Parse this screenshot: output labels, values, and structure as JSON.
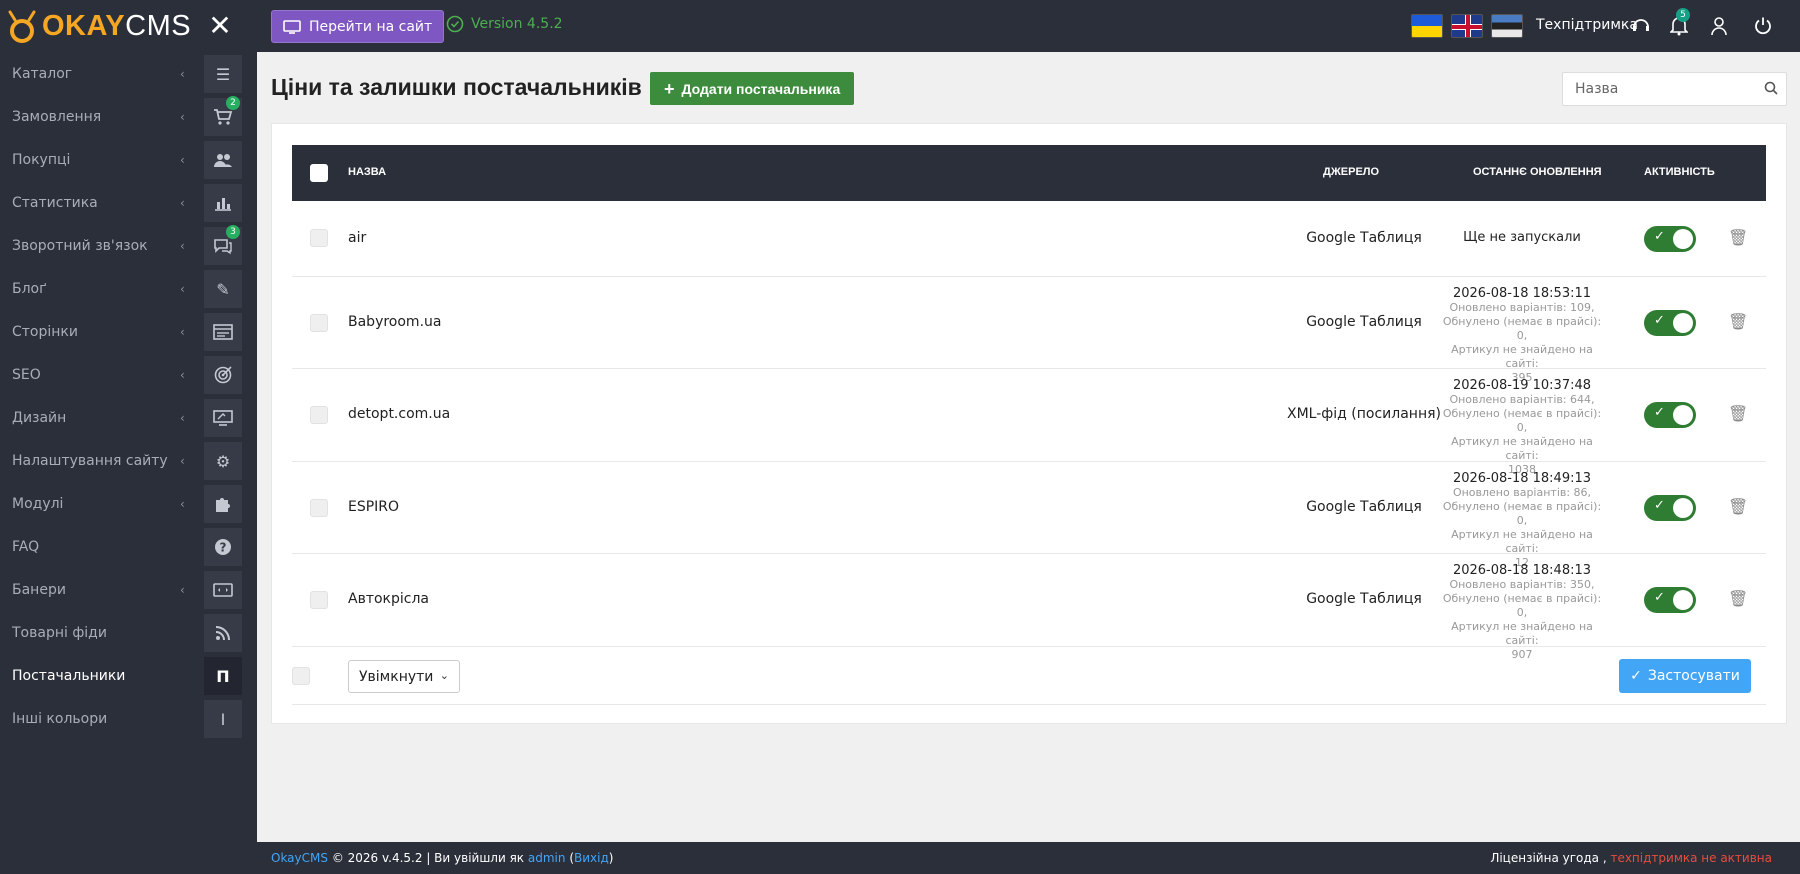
{
  "topbar": {
    "logo_okay": "OKAY",
    "logo_cms": "CMS",
    "goto_site": "Перейти на сайт",
    "version": "Version 4.5.2",
    "support": "Техпідтримка",
    "notifications_count": "5"
  },
  "sidebar": {
    "items": [
      {
        "label": "Каталог",
        "icon": "list-icon",
        "badge": ""
      },
      {
        "label": "Замовлення",
        "icon": "cart-icon",
        "badge": "2"
      },
      {
        "label": "Покупці",
        "icon": "users-icon",
        "badge": ""
      },
      {
        "label": "Статистика",
        "icon": "chart-icon",
        "badge": ""
      },
      {
        "label": "Зворотний зв'язок",
        "icon": "comments-icon",
        "badge": "3"
      },
      {
        "label": "Блоґ",
        "icon": "pencil-icon",
        "badge": ""
      },
      {
        "label": "Сторінки",
        "icon": "pages-icon",
        "badge": ""
      },
      {
        "label": "SEO",
        "icon": "target-icon",
        "badge": ""
      },
      {
        "label": "Дизайн",
        "icon": "monitor-icon",
        "badge": ""
      },
      {
        "label": "Налаштування сайту",
        "icon": "gear-icon",
        "badge": ""
      },
      {
        "label": "Модулі",
        "icon": "puzzle-icon",
        "badge": ""
      },
      {
        "label": "FAQ",
        "icon": "question-icon",
        "badge": ""
      },
      {
        "label": "Банери",
        "icon": "banner-icon",
        "badge": ""
      },
      {
        "label": "Товарні фіди",
        "icon": "rss-icon",
        "badge": ""
      },
      {
        "label": "Постачальники",
        "icon": "letter-p-icon",
        "badge": "",
        "letter": "П"
      },
      {
        "label": "Інші кольори",
        "icon": "letter-i-icon",
        "badge": "",
        "letter": "І"
      }
    ]
  },
  "main": {
    "title": "Ціни та залишки постачальників",
    "add_button": "Додати постачальника",
    "search_placeholder": "Назва",
    "table": {
      "headers": {
        "name": "Назва",
        "source": "Джерело",
        "last_update": "Останнє оновлення",
        "activity": "Активність"
      },
      "rows": [
        {
          "name": "air",
          "source": "Google Таблиця",
          "date": "Ще не запускали",
          "info": []
        },
        {
          "name": "Babyroom.ua",
          "source": "Google Таблиця",
          "date": "2026-08-18 18:53:11",
          "info": [
            "Оновлено варіантів: 109,",
            "Обнулено (немає в прайсі): 0,",
            "Артикул не знайдено на сайті:",
            "395"
          ]
        },
        {
          "name": "detopt.com.ua",
          "source": "XML-фід (посилання)",
          "date": "2026-08-19 10:37:48",
          "info": [
            "Оновлено варіантів: 644,",
            "Обнулено (немає в прайсі): 0,",
            "Артикул не знайдено на сайті:",
            "1038"
          ]
        },
        {
          "name": "ESPIRO",
          "source": "Google Таблиця",
          "date": "2026-08-18 18:49:13",
          "info": [
            "Оновлено варіантів: 86,",
            "Обнулено (немає в прайсі): 0,",
            "Артикул не знайдено на сайті:",
            "12"
          ]
        },
        {
          "name": "Автокрісла",
          "source": "Google Таблиця",
          "date": "2026-08-18 18:48:13",
          "info": [
            "Оновлено варіантів: 350,",
            "Обнулено (немає в прайсі): 0,",
            "Артикул не знайдено на сайті:",
            "907"
          ]
        }
      ]
    },
    "bulk_action": "Увімкнути",
    "apply_button": "Застосувати"
  },
  "footer": {
    "brand": "OkayCMS",
    "text": " © 2026 v.4.5.2 | Ви увійшли як ",
    "user": "admin",
    "logout": "Вихід",
    "license": "Ліцензійна угода ,",
    "support_status": " техпідтримка не активна"
  },
  "colors": {
    "topbar_bg": "#2b2f3a",
    "purple_button": "#7e57c2",
    "green_button": "#3d8b3d",
    "toggle_on": "#2e7d32",
    "apply_blue": "#42a5f5",
    "version_green": "#4caf50"
  }
}
